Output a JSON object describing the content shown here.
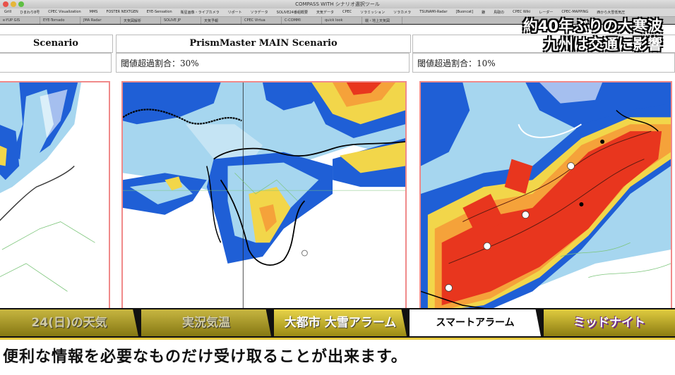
{
  "window": {
    "title": "COMPASS WITH シナリオ選択ツール",
    "bookmarks": [
      "Grill",
      "ひまわり8号",
      "CPEC Visualization",
      "MMS",
      "FOSTER NEXTGEN",
      "EYE-Sensation",
      "衛星画像・ライブカメラ",
      "リポート",
      "ソラデータ",
      "SOLIVE24番組概要",
      "天気データ",
      "CPEC",
      "ソラミッション",
      "ソラカメラ",
      "TSUNAMI-Radar",
      "[Buoncat]",
      "鎌",
      "鳥取の",
      "CPEC Wiki",
      "レーダー",
      "CPEC-MAPPING",
      "西から大雪低気圧"
    ],
    "tabs": [
      "e-YUP GIS",
      "EYE-Tornado",
      "JMA Radar",
      "天気図解析",
      "SOLIVE JP",
      "天気予報",
      "CPEC Virtua",
      "C-COMMI",
      "quick look",
      "戦・地上天気図"
    ]
  },
  "columns": [
    {
      "heading": "Scenario",
      "subtitle": ""
    },
    {
      "heading": "PrismMaster MAIN Scenario",
      "subtitle": "閾値超過割合：30%"
    },
    {
      "heading": "",
      "subtitle": "閾値超過割合：10%"
    }
  ],
  "news": {
    "line1": "約40年ぶりの大寒波",
    "line2": "九州は交通に影響"
  },
  "menu": {
    "items": [
      {
        "label": "24(日)の天気",
        "state": "dim"
      },
      {
        "label": "実況気温",
        "state": "dim"
      },
      {
        "label": "大都市 大雪アラーム",
        "state": "normal"
      },
      {
        "label": "スマートアラーム",
        "state": "active"
      }
    ],
    "program": "ミッドナイト"
  },
  "subtitle": "便利な情報を必要なものだけ受け取ることが出来ます。",
  "colors": {
    "accent": "#e6c93c",
    "map_blue": "#1f5fd6",
    "map_lightblue": "#a6d6ef",
    "map_red": "#e8361e"
  }
}
